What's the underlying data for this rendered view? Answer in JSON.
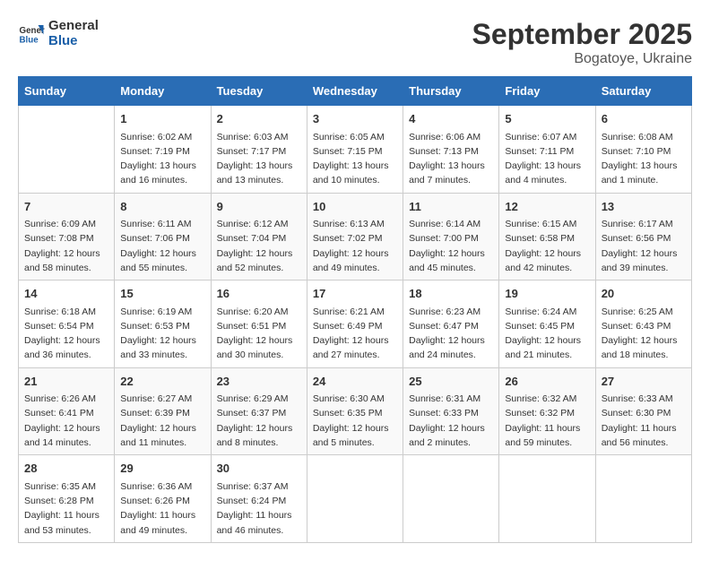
{
  "logo": {
    "line1": "General",
    "line2": "Blue"
  },
  "title": "September 2025",
  "location": "Bogatoye, Ukraine",
  "days_of_week": [
    "Sunday",
    "Monday",
    "Tuesday",
    "Wednesday",
    "Thursday",
    "Friday",
    "Saturday"
  ],
  "weeks": [
    [
      {
        "day": "",
        "sunrise": "",
        "sunset": "",
        "daylight": ""
      },
      {
        "day": "1",
        "sunrise": "Sunrise: 6:02 AM",
        "sunset": "Sunset: 7:19 PM",
        "daylight": "Daylight: 13 hours and 16 minutes."
      },
      {
        "day": "2",
        "sunrise": "Sunrise: 6:03 AM",
        "sunset": "Sunset: 7:17 PM",
        "daylight": "Daylight: 13 hours and 13 minutes."
      },
      {
        "day": "3",
        "sunrise": "Sunrise: 6:05 AM",
        "sunset": "Sunset: 7:15 PM",
        "daylight": "Daylight: 13 hours and 10 minutes."
      },
      {
        "day": "4",
        "sunrise": "Sunrise: 6:06 AM",
        "sunset": "Sunset: 7:13 PM",
        "daylight": "Daylight: 13 hours and 7 minutes."
      },
      {
        "day": "5",
        "sunrise": "Sunrise: 6:07 AM",
        "sunset": "Sunset: 7:11 PM",
        "daylight": "Daylight: 13 hours and 4 minutes."
      },
      {
        "day": "6",
        "sunrise": "Sunrise: 6:08 AM",
        "sunset": "Sunset: 7:10 PM",
        "daylight": "Daylight: 13 hours and 1 minute."
      }
    ],
    [
      {
        "day": "7",
        "sunrise": "Sunrise: 6:09 AM",
        "sunset": "Sunset: 7:08 PM",
        "daylight": "Daylight: 12 hours and 58 minutes."
      },
      {
        "day": "8",
        "sunrise": "Sunrise: 6:11 AM",
        "sunset": "Sunset: 7:06 PM",
        "daylight": "Daylight: 12 hours and 55 minutes."
      },
      {
        "day": "9",
        "sunrise": "Sunrise: 6:12 AM",
        "sunset": "Sunset: 7:04 PM",
        "daylight": "Daylight: 12 hours and 52 minutes."
      },
      {
        "day": "10",
        "sunrise": "Sunrise: 6:13 AM",
        "sunset": "Sunset: 7:02 PM",
        "daylight": "Daylight: 12 hours and 49 minutes."
      },
      {
        "day": "11",
        "sunrise": "Sunrise: 6:14 AM",
        "sunset": "Sunset: 7:00 PM",
        "daylight": "Daylight: 12 hours and 45 minutes."
      },
      {
        "day": "12",
        "sunrise": "Sunrise: 6:15 AM",
        "sunset": "Sunset: 6:58 PM",
        "daylight": "Daylight: 12 hours and 42 minutes."
      },
      {
        "day": "13",
        "sunrise": "Sunrise: 6:17 AM",
        "sunset": "Sunset: 6:56 PM",
        "daylight": "Daylight: 12 hours and 39 minutes."
      }
    ],
    [
      {
        "day": "14",
        "sunrise": "Sunrise: 6:18 AM",
        "sunset": "Sunset: 6:54 PM",
        "daylight": "Daylight: 12 hours and 36 minutes."
      },
      {
        "day": "15",
        "sunrise": "Sunrise: 6:19 AM",
        "sunset": "Sunset: 6:53 PM",
        "daylight": "Daylight: 12 hours and 33 minutes."
      },
      {
        "day": "16",
        "sunrise": "Sunrise: 6:20 AM",
        "sunset": "Sunset: 6:51 PM",
        "daylight": "Daylight: 12 hours and 30 minutes."
      },
      {
        "day": "17",
        "sunrise": "Sunrise: 6:21 AM",
        "sunset": "Sunset: 6:49 PM",
        "daylight": "Daylight: 12 hours and 27 minutes."
      },
      {
        "day": "18",
        "sunrise": "Sunrise: 6:23 AM",
        "sunset": "Sunset: 6:47 PM",
        "daylight": "Daylight: 12 hours and 24 minutes."
      },
      {
        "day": "19",
        "sunrise": "Sunrise: 6:24 AM",
        "sunset": "Sunset: 6:45 PM",
        "daylight": "Daylight: 12 hours and 21 minutes."
      },
      {
        "day": "20",
        "sunrise": "Sunrise: 6:25 AM",
        "sunset": "Sunset: 6:43 PM",
        "daylight": "Daylight: 12 hours and 18 minutes."
      }
    ],
    [
      {
        "day": "21",
        "sunrise": "Sunrise: 6:26 AM",
        "sunset": "Sunset: 6:41 PM",
        "daylight": "Daylight: 12 hours and 14 minutes."
      },
      {
        "day": "22",
        "sunrise": "Sunrise: 6:27 AM",
        "sunset": "Sunset: 6:39 PM",
        "daylight": "Daylight: 12 hours and 11 minutes."
      },
      {
        "day": "23",
        "sunrise": "Sunrise: 6:29 AM",
        "sunset": "Sunset: 6:37 PM",
        "daylight": "Daylight: 12 hours and 8 minutes."
      },
      {
        "day": "24",
        "sunrise": "Sunrise: 6:30 AM",
        "sunset": "Sunset: 6:35 PM",
        "daylight": "Daylight: 12 hours and 5 minutes."
      },
      {
        "day": "25",
        "sunrise": "Sunrise: 6:31 AM",
        "sunset": "Sunset: 6:33 PM",
        "daylight": "Daylight: 12 hours and 2 minutes."
      },
      {
        "day": "26",
        "sunrise": "Sunrise: 6:32 AM",
        "sunset": "Sunset: 6:32 PM",
        "daylight": "Daylight: 11 hours and 59 minutes."
      },
      {
        "day": "27",
        "sunrise": "Sunrise: 6:33 AM",
        "sunset": "Sunset: 6:30 PM",
        "daylight": "Daylight: 11 hours and 56 minutes."
      }
    ],
    [
      {
        "day": "28",
        "sunrise": "Sunrise: 6:35 AM",
        "sunset": "Sunset: 6:28 PM",
        "daylight": "Daylight: 11 hours and 53 minutes."
      },
      {
        "day": "29",
        "sunrise": "Sunrise: 6:36 AM",
        "sunset": "Sunset: 6:26 PM",
        "daylight": "Daylight: 11 hours and 49 minutes."
      },
      {
        "day": "30",
        "sunrise": "Sunrise: 6:37 AM",
        "sunset": "Sunset: 6:24 PM",
        "daylight": "Daylight: 11 hours and 46 minutes."
      },
      {
        "day": "",
        "sunrise": "",
        "sunset": "",
        "daylight": ""
      },
      {
        "day": "",
        "sunrise": "",
        "sunset": "",
        "daylight": ""
      },
      {
        "day": "",
        "sunrise": "",
        "sunset": "",
        "daylight": ""
      },
      {
        "day": "",
        "sunrise": "",
        "sunset": "",
        "daylight": ""
      }
    ]
  ]
}
